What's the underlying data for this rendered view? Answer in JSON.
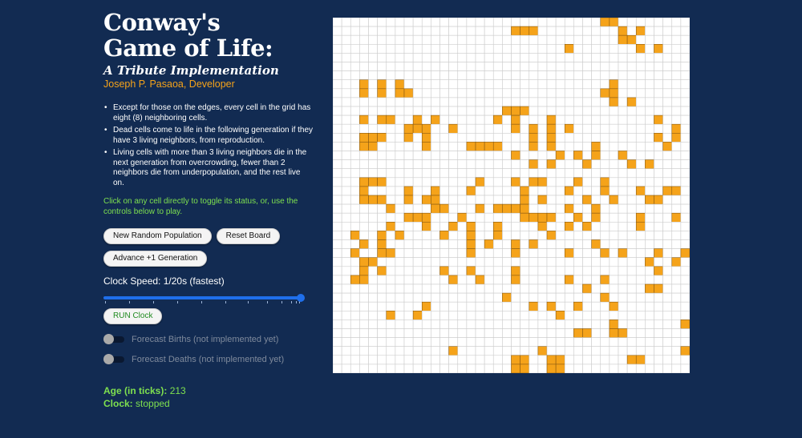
{
  "header": {
    "title_line1": "Conway's",
    "title_line2": "Game of Life:",
    "subtitle": "A Tribute Implementation",
    "author": "Joseph P. Pasaoa, Developer"
  },
  "rules": [
    "Except for those on the edges, every cell in the grid has eight (8) neighboring cells.",
    "Dead cells come to life in the following generation if they have 3 living neighbors, from reproduction.",
    "Living cells with more than 3 living neighbors die in the next generation from overcrowding, fewer than 2 neighbors die from underpopulation, and the rest live on."
  ],
  "hint": "Click on any cell directly to toggle its status, or, use the controls below to play.",
  "controls": {
    "new_random": "New Random Population",
    "reset": "Reset Board",
    "advance": "Advance +1 Generation",
    "speed_label": "Clock Speed: 1/20s (fastest)",
    "speed_value_fraction": 1.0,
    "run": "RUN Clock"
  },
  "toggles": {
    "births": {
      "label": "Forecast Births (not implemented yet)",
      "on": false
    },
    "deaths": {
      "label": "Forecast Deaths (not implemented yet)",
      "on": false
    }
  },
  "stats": {
    "age_label": "Age (in ticks):",
    "age_value": "213",
    "clock_label": "Clock:",
    "clock_value": "stopped"
  },
  "colors": {
    "background": "#122b52",
    "live_cell": "#f5a31a",
    "dead_cell": "#ffffff",
    "grid_line": "#cccccc",
    "accent_green": "#7ee04f",
    "accent_orange": "#f5a31a",
    "slider": "#1f6feb"
  },
  "board": {
    "cols": 40,
    "rows": 40,
    "rows_data": [
      "..............................##........",
      "....................###.........#.#.....",
      "................................##......",
      "..........................#.......#.#...",
      "........................................",
      "........................................",
      "........................................",
      "...#.#.#.......................#........",
      "...#.#.##.....................##........",
      "...............................#.#......",
      "...................###..................",
      "...#.##..#.#......#.#...#...........#...",
      "........###..#......#.#.#.#...........#.",
      "...###..#.#...........#.#...........#.#.",
      "...##.....#....####...#.#....#.......#..",
      "....................#....#.#.#..#.......",
      "......................#.#...#....#.#....",
      "........................................",
      "...###..........#...#.##...#..#.........",
      "...#....#..#...#.....#....#...#...#..##.",
      "...###..#.##.........#.#....#..#...##...",
      "......#....##...#.####....#..#..........",
      "........###...#......####..#.#....#...#.",
      "......#...#..#.#..#....#..#.#.....#.....",
      "..#..#.#....#..#..#.....#...............",
      "...#.#.........#.#..#.#......#..........",
      "..#..##........#....#.....#...#.#...#..#",
      "...##..............................#..#.",
      "...#.#......#..#....#...............#...",
      "..##.........#..#...#.....#...#.........",
      "............................#......##...",
      "...................#..........#.........",
      "..........#...........#.#..#...#........",
      "......#..#...............#..............",
      "...............................#.......#",
      "...........................##..##.......",
      "........................................",
      ".............#.........#...............#",
      "....................##..##.......##.....",
      "....................##..##.............."
    ]
  }
}
